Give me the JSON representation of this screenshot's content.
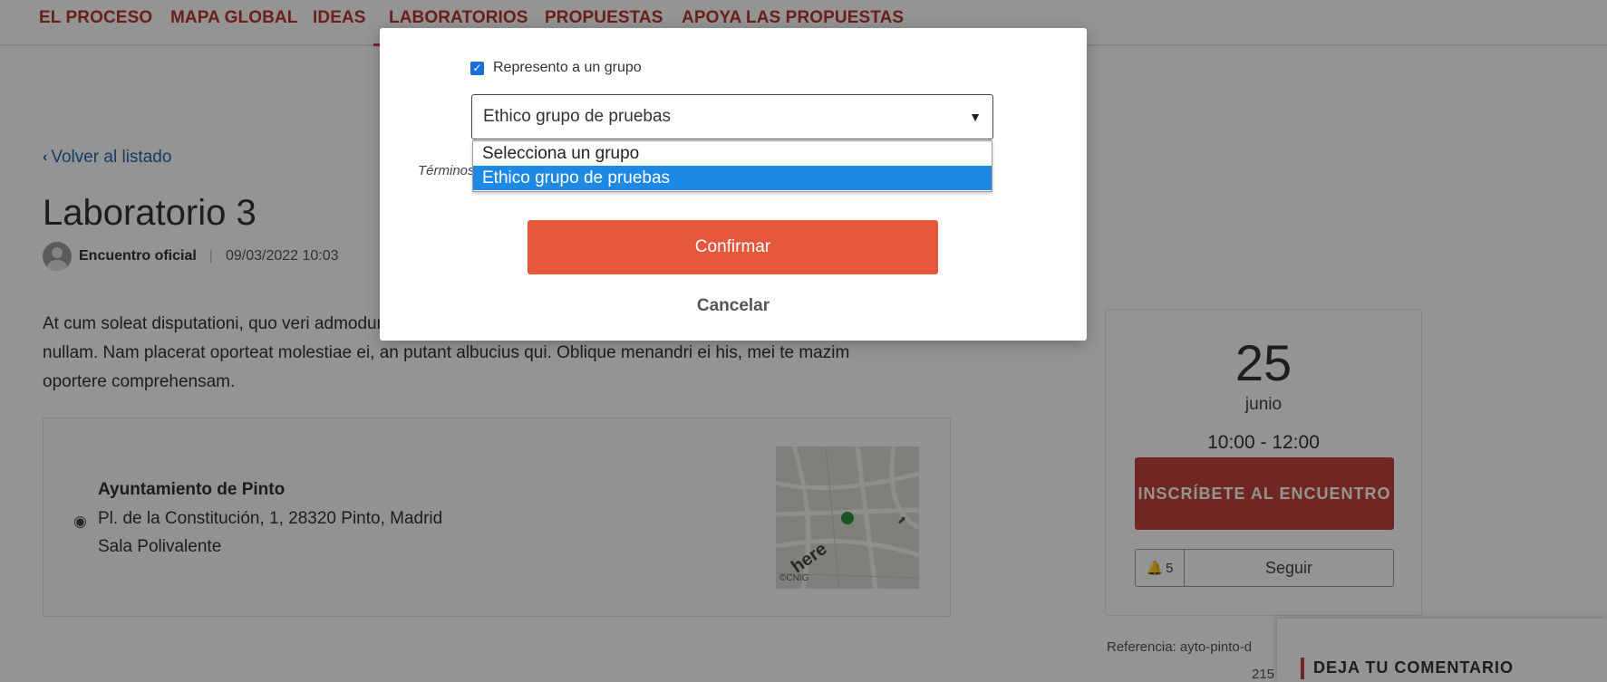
{
  "nav": {
    "items": [
      "EL PROCESO",
      "MAPA GLOBAL",
      "IDEAS",
      "LABORATORIOS",
      "PROPUESTAS",
      "APOYA LAS PROPUESTAS"
    ],
    "active": "LABORATORIOS"
  },
  "page": {
    "back_label": "Volver al listado",
    "title": "Laboratorio 3",
    "author": "Encuentro oficial",
    "date": "09/03/2022 10:03",
    "description": "At cum soleat disputationi, quo veri admodum vituperata ad. Ea vix ceteros complectitur, vel cu nihil nullam. Nam placerat oporteat molestiae ei, an putant albucius qui. Oblique menandri ei his, mei te mazim oportere comprehensam."
  },
  "location": {
    "name": "Ayuntamiento de Pinto",
    "address": "Pl. de la Constitución, 1, 28320 Pinto, Madrid",
    "room": "Sala Polivalente",
    "map_brand": "here",
    "map_credit": "©CNIG"
  },
  "event": {
    "day": "25",
    "month": "junio",
    "time": "10:00 - 12:00",
    "inscribe_label": "INSCRÍBETE AL ENCUENTRO",
    "followers": "5",
    "follow_label": "Seguir",
    "reference": "Referencia: ayto-pinto-d",
    "reference_num": "215"
  },
  "comment": {
    "title": "DEJA TU COMENTARIO"
  },
  "modal": {
    "checkbox_label": "Represento a un grupo",
    "checkbox_checked": true,
    "select_value": "Ethico grupo de pruebas",
    "options": [
      "Selecciona un grupo",
      "Ethico grupo de pruebas"
    ],
    "selected_option": "Ethico grupo de pruebas",
    "terms_label": "Términos",
    "confirm_label": "Confirmar",
    "cancel_label": "Cancelar"
  },
  "colors": {
    "accent": "#b8362a",
    "confirm": "#e5583e",
    "inscribe": "#c3443a",
    "link": "#2466a8",
    "option_highlight": "#1e88e5"
  }
}
